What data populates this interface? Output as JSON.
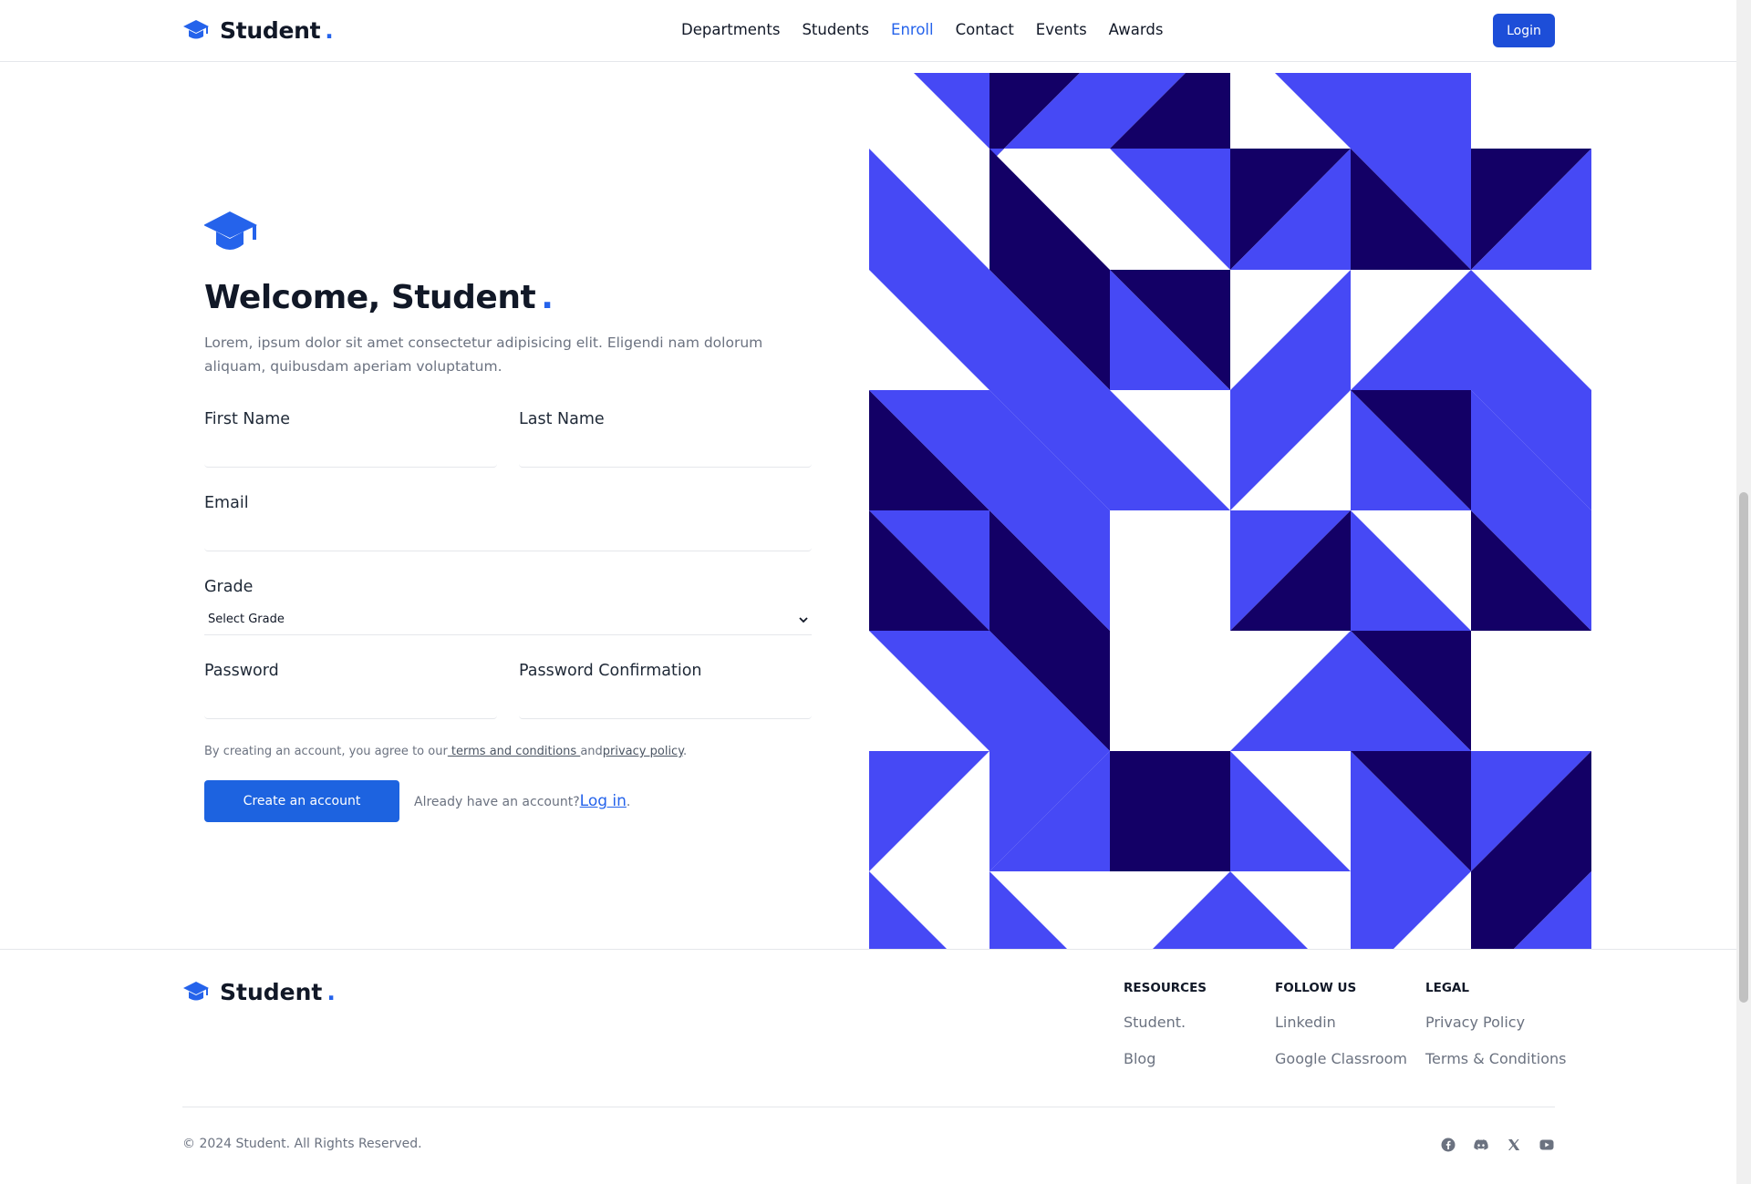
{
  "brand": {
    "name": "Student",
    "dot": "."
  },
  "nav": {
    "items": [
      {
        "label": "Departments",
        "active": false
      },
      {
        "label": "Students",
        "active": false
      },
      {
        "label": "Enroll",
        "active": true
      },
      {
        "label": "Contact",
        "active": false
      },
      {
        "label": "Events",
        "active": false
      },
      {
        "label": "Awards",
        "active": false
      }
    ],
    "login_label": "Login"
  },
  "form": {
    "title": "Welcome, Student",
    "title_dot": ".",
    "description": "Lorem, ipsum dolor sit amet consectetur adipisicing elit. Eligendi nam dolorum aliquam, quibusdam aperiam voluptatum.",
    "first_name_label": "First Name",
    "first_name_value": "",
    "last_name_label": "Last Name",
    "last_name_value": "",
    "email_label": "Email",
    "email_value": "",
    "grade_label": "Grade",
    "grade_selected": "Select Grade",
    "password_label": "Password",
    "password_confirm_label": "Password Confirmation",
    "terms_prefix": "By creating an account, you agree to our",
    "terms_link": " terms and conditions ",
    "terms_and": "and",
    "privacy_link": "privacy policy",
    "terms_suffix": ".",
    "create_label": "Create an account",
    "already_text": "Already have an account?",
    "login_link": "Log in",
    "login_suffix": "."
  },
  "colors": {
    "accent": "#2563eb",
    "pattern_light": "#4649f5",
    "pattern_dark": "#130066"
  },
  "footer": {
    "resources_heading": "RESOURCES",
    "resources_links": [
      "Student.",
      "Blog"
    ],
    "follow_heading": "FOLLOW US",
    "follow_links": [
      "Linkedin",
      "Google Classroom"
    ],
    "legal_heading": "LEGAL",
    "legal_links": [
      "Privacy Policy",
      "Terms & Conditions"
    ],
    "copyright": "© 2024 Student. All Rights Reserved.",
    "social_icons": [
      "facebook-icon",
      "discord-icon",
      "x-icon",
      "youtube-icon"
    ]
  }
}
